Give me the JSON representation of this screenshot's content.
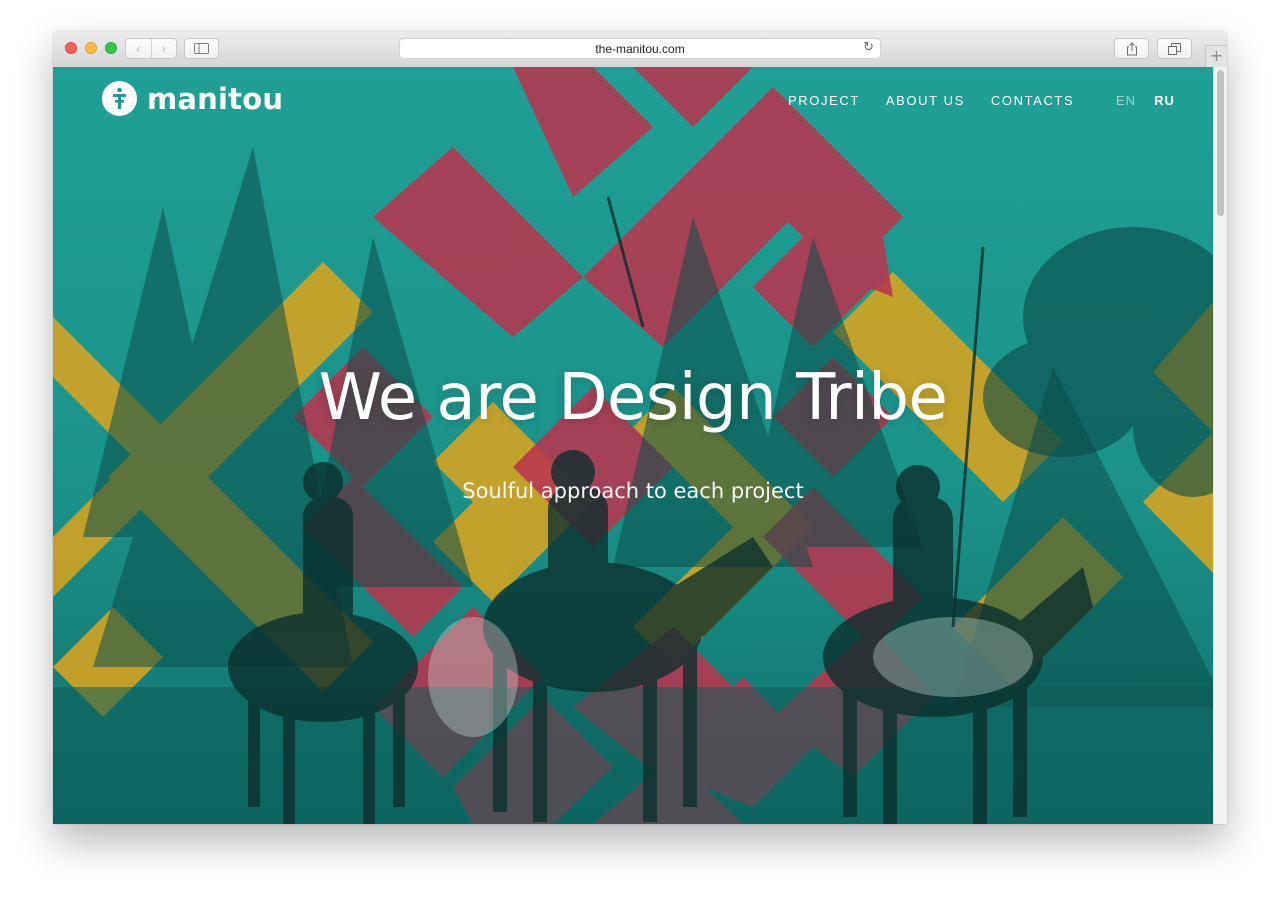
{
  "browser": {
    "url": "the-manitou.com",
    "icons": {
      "back": "chevron-left-icon",
      "forward": "chevron-right-icon",
      "sidebar": "sidebar-icon",
      "reload": "reload-icon",
      "share": "share-icon",
      "tabs": "tabs-icon",
      "new_tab": "plus-icon"
    }
  },
  "site": {
    "logo_text": "manitou",
    "nav": [
      {
        "label": "PROJECT"
      },
      {
        "label": "ABOUT US"
      },
      {
        "label": "CONTACTS"
      }
    ],
    "languages": [
      {
        "label": "EN",
        "active": false
      },
      {
        "label": "RU",
        "active": true
      }
    ],
    "hero": {
      "title": "We are Design Tribe",
      "subtitle": "Soulful approach to each project"
    },
    "colors": {
      "teal": "#1f9a92",
      "red": "#b8364f",
      "ochre": "#d9a41f",
      "text": "#ffffff"
    }
  }
}
